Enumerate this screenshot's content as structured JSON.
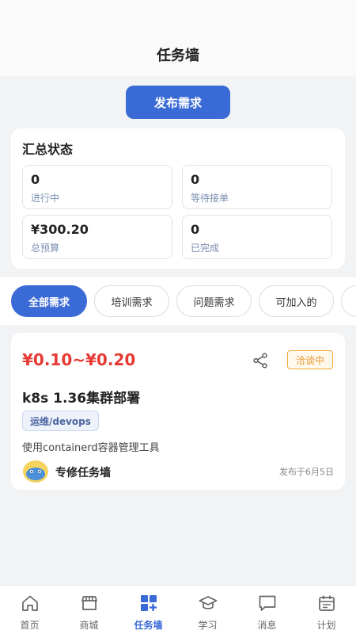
{
  "header": {
    "title": "任务墙"
  },
  "publish_button": {
    "label": "发布需求"
  },
  "summary": {
    "title": "汇总状态",
    "stats": [
      {
        "value": "0",
        "label": "进行中"
      },
      {
        "value": "0",
        "label": "等待接单"
      },
      {
        "value": "¥300.20",
        "label": "总预算"
      },
      {
        "value": "0",
        "label": "已完成"
      }
    ]
  },
  "tabs": [
    {
      "label": "全部需求",
      "active": true
    },
    {
      "label": "培训需求",
      "active": false
    },
    {
      "label": "问题需求",
      "active": false
    },
    {
      "label": "可加入的",
      "active": false
    }
  ],
  "task": {
    "price": "¥0.10~¥0.20",
    "status": "洽谈中",
    "title": "k8s 1.36集群部署",
    "tag": "运维/devops",
    "description": "使用containerd容器管理工具",
    "author": "专修任务墙",
    "date": "发布于6月5日"
  },
  "nav": [
    {
      "label": "首页",
      "icon": "home-icon",
      "active": false
    },
    {
      "label": "商城",
      "icon": "store-icon",
      "active": false
    },
    {
      "label": "任务墙",
      "icon": "grid-plus-icon",
      "active": true
    },
    {
      "label": "学习",
      "icon": "graduation-cap-icon",
      "active": false
    },
    {
      "label": "消息",
      "icon": "message-icon",
      "active": false
    },
    {
      "label": "计划",
      "icon": "calendar-icon",
      "active": false
    }
  ],
  "colors": {
    "accent": "#3a6ad6",
    "price": "#e53a35",
    "badge": "#e8952a"
  }
}
